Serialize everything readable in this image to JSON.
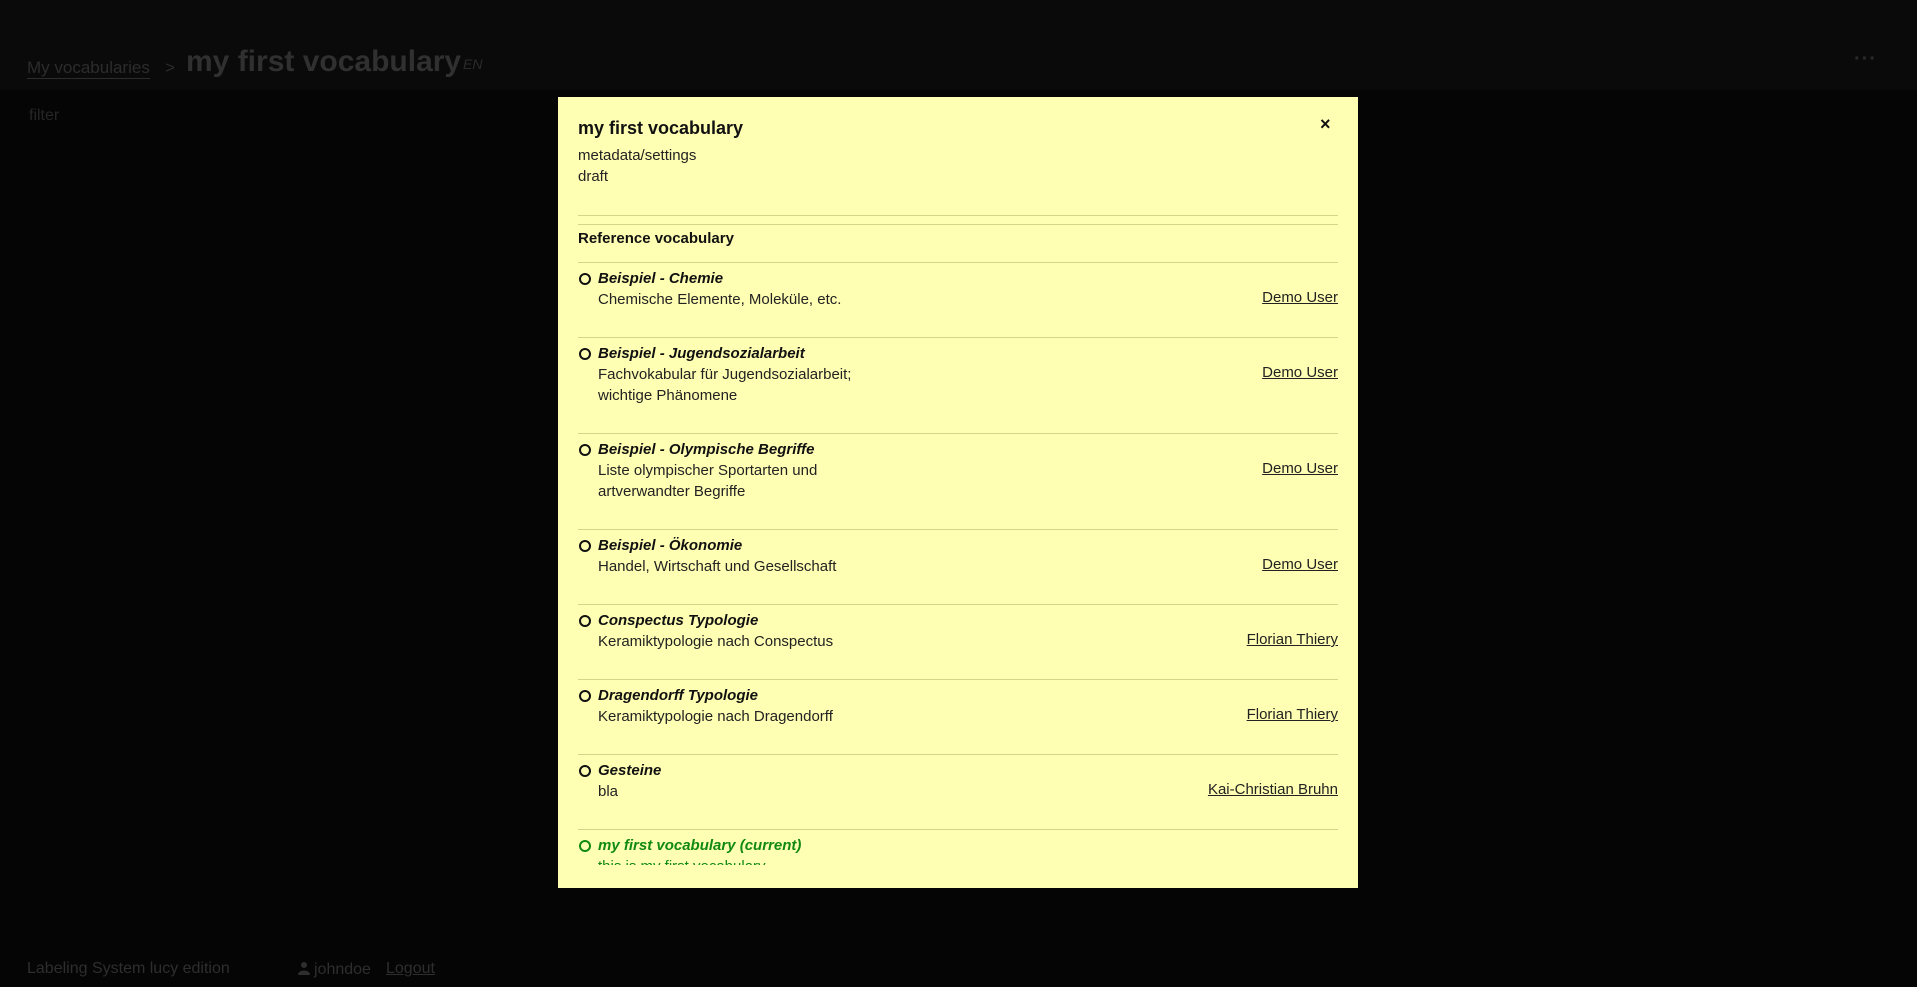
{
  "header": {
    "breadcrumb_link": "My vocabularies",
    "breadcrumb_sep": ">",
    "title": "my first vocabulary",
    "lang": "EN",
    "more": "···"
  },
  "filter": {
    "placeholder": "filter"
  },
  "footer": {
    "app_name": "Labeling System lucy edition",
    "username": "johndoe",
    "logout": "Logout"
  },
  "modal": {
    "title": "my first vocabulary",
    "close": "×",
    "subtitle1": "metadata/settings",
    "subtitle2": "draft",
    "section": "Reference vocabulary",
    "items": [
      {
        "title": "Beispiel - Chemie",
        "desc": "Chemische Elemente, Moleküle, etc.",
        "desc2": "",
        "owner": "Demo User"
      },
      {
        "title": "Beispiel - Jugendsozialarbeit",
        "desc": "Fachvokabular für Jugendsozialarbeit;",
        "desc2": "wichtige Phänomene",
        "owner": "Demo User"
      },
      {
        "title": "Beispiel - Olympische Begriffe",
        "desc": "Liste olympischer Sportarten und",
        "desc2": "artverwandter Begriffe",
        "owner": "Demo User"
      },
      {
        "title": "Beispiel - Ökonomie",
        "desc": "Handel, Wirtschaft und Gesellschaft",
        "desc2": "",
        "owner": "Demo User"
      },
      {
        "title": "Conspectus Typologie",
        "desc": "Keramiktypologie nach Conspectus",
        "desc2": "",
        "owner": "Florian Thiery"
      },
      {
        "title": "Dragendorff Typologie",
        "desc": "Keramiktypologie nach Dragendorff",
        "desc2": "",
        "owner": "Florian Thiery"
      },
      {
        "title": "Gesteine",
        "desc": "bla",
        "desc2": "",
        "owner": "Kai-Christian Bruhn"
      },
      {
        "title": "my first vocabulary (current)",
        "desc": "this is my first vocabulary",
        "desc2": "",
        "owner": ""
      }
    ]
  },
  "colors": {
    "modal_bg": "#ffffb3",
    "current": "#118a11",
    "page_bg": "#050505"
  }
}
